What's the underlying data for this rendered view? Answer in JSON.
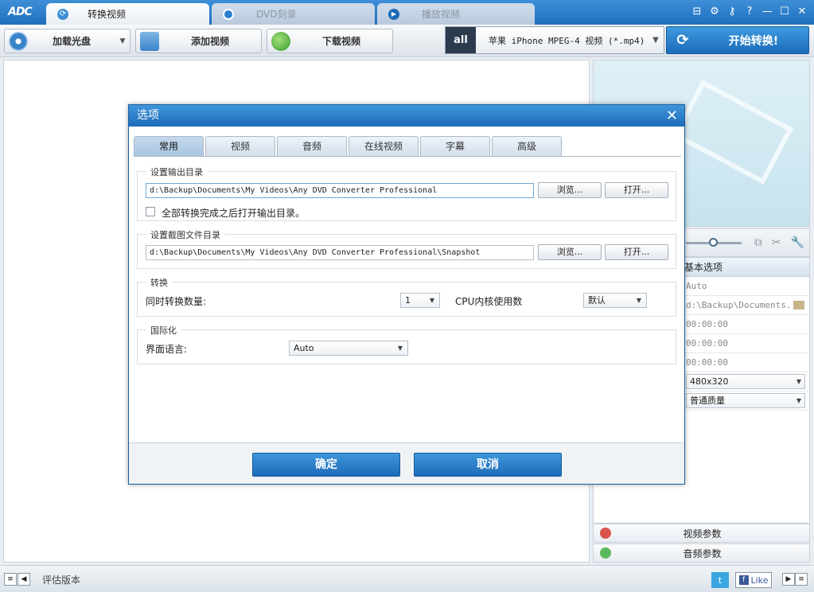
{
  "app": {
    "logo": "ADC",
    "tabs": [
      {
        "label": "转换视频",
        "icon": "refresh-icon",
        "active": true
      },
      {
        "label": "DVD刻录",
        "icon": "disc-icon",
        "active": false
      },
      {
        "label": "播放视频",
        "icon": "play-icon",
        "active": false
      }
    ],
    "window_buttons": [
      "register-icon",
      "gear-icon",
      "key-icon",
      "help-icon",
      "minimize-icon",
      "maximize-icon",
      "close-icon"
    ],
    "window_glyphs": [
      "⊟",
      "⚙",
      "⚷",
      "?",
      "—",
      "☐",
      "✕"
    ]
  },
  "toolbar": {
    "load_disc": "加载光盘",
    "add_video": "添加视频",
    "download_video": "下载视频",
    "profile_icon_text": "all",
    "profile": "苹果 iPhone MPEG-4 视频 (*.mp4)",
    "start": "开始转换!"
  },
  "props": {
    "header": "基本选项",
    "rows": [
      "Auto",
      "d:\\Backup\\Documents...",
      "00:00:00",
      "00:00:00",
      "00:00:00"
    ],
    "resolution": "480x320",
    "quality": "普通质量"
  },
  "params": {
    "video": "视频参数",
    "audio": "音频参数"
  },
  "statusbar": {
    "text": "评估版本",
    "like": "Like"
  },
  "dialog": {
    "title": "选项",
    "tabs": [
      "常用",
      "视频",
      "音频",
      "在线视频",
      "字幕",
      "高级"
    ],
    "output_group": "设置输出目录",
    "output_path": "d:\\Backup\\Documents\\My Videos\\Any DVD Converter Professional",
    "browse": "浏览...",
    "open": "打开...",
    "open_after": "全部转换完成之后打开输出目录。",
    "snapshot_group": "设置截图文件目录",
    "snapshot_path": "d:\\Backup\\Documents\\My Videos\\Any DVD Converter Professional\\Snapshot",
    "convert_group": "转换",
    "concurrent_label": "同时转换数量:",
    "concurrent_value": "1",
    "cpu_label": "CPU内核使用数",
    "cpu_value": "默认",
    "intl_group": "国际化",
    "language_label": "界面语言:",
    "language_value": "Auto",
    "ok": "确定",
    "cancel": "取消"
  }
}
